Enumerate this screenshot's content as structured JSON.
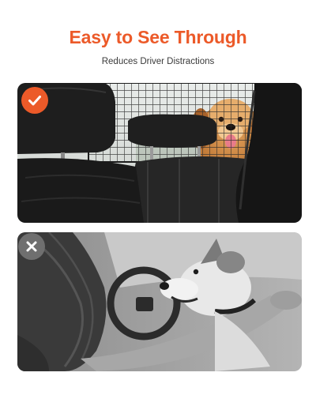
{
  "headline": {
    "title": "Easy to See Through",
    "subtitle": "Reduces Driver Distractions"
  },
  "colors": {
    "accent": "#ec5a29",
    "title": "#ec5a29",
    "check_badge": "#ec5a29",
    "cross_badge": "#6f6f6f"
  },
  "panels": {
    "good": {
      "badge_icon": "checkmark-icon"
    },
    "bad": {
      "badge_icon": "cross-icon"
    }
  }
}
